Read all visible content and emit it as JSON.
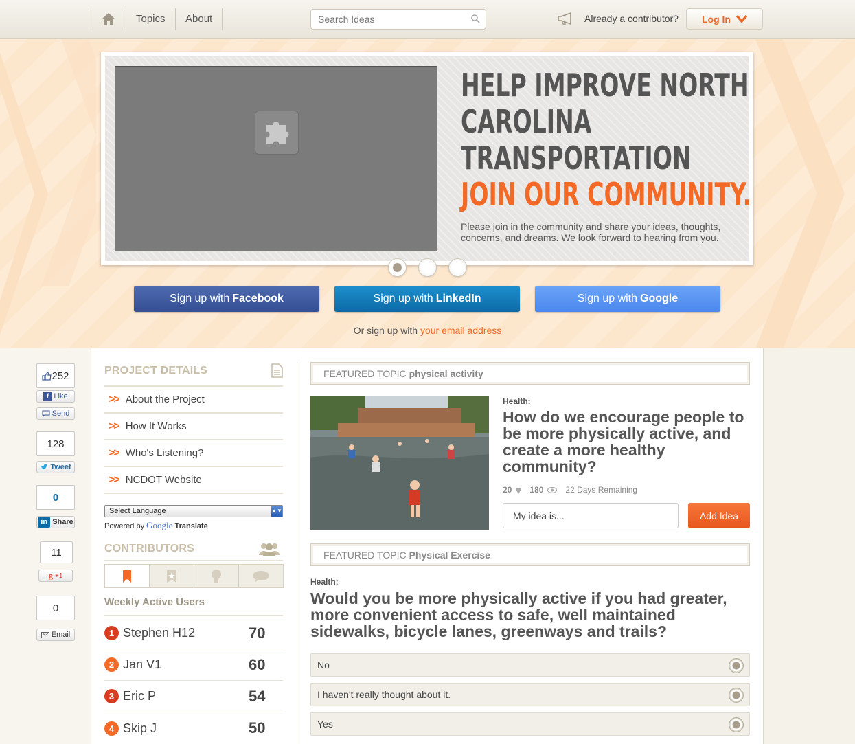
{
  "nav": {
    "links": [
      "Topics",
      "About"
    ],
    "search_placeholder": "Search Ideas",
    "contributor_text": "Already a contributor?",
    "login_label": "Log In"
  },
  "hero": {
    "headline_lines": [
      "HELP IMPROVE NORTH",
      "CAROLINA",
      "TRANSPORTATION"
    ],
    "headline_accent": "JOIN OUR COMMUNITY.",
    "intro": "Please join in the community and share your ideas, thoughts, concerns, and dreams. We look forward to hearing from you.",
    "signup": {
      "prefix": "Sign up with",
      "facebook": "Facebook",
      "linkedin": "LinkedIn",
      "google": "Google"
    },
    "or_text": "Or sign up with",
    "email_link": "your email address"
  },
  "share": {
    "like_count": "252",
    "like_label": "Like",
    "send_label": "Send",
    "tweet_count": "128",
    "tweet_label": "Tweet",
    "linkedin_count": "0",
    "linkedin_label": "Share",
    "gplus_count": "11",
    "gplus_label": "+1",
    "email_count": "0",
    "email_label": "Email"
  },
  "project": {
    "title": "PROJECT DETAILS",
    "items": [
      "About the Project",
      "How It Works",
      "Who's Listening?",
      "NCDOT Website"
    ],
    "language_select": "Select Language",
    "powered_by": "Powered by",
    "google": "Google",
    "translate": "Translate"
  },
  "contributors": {
    "title": "CONTRIBUTORS",
    "subtitle": "Weekly Active Users",
    "users": [
      {
        "rank": "1",
        "name": "Stephen H12",
        "score": "70"
      },
      {
        "rank": "2",
        "name": "Jan V1",
        "score": "60"
      },
      {
        "rank": "3",
        "name": "Eric P",
        "score": "54"
      },
      {
        "rank": "4",
        "name": "Skip J",
        "score": "50"
      }
    ]
  },
  "featured1": {
    "label": "FEATURED TOPIC",
    "topic": "physical activity",
    "category": "Health:",
    "question": "How do we encourage people to be more physically active, and create a more healthy community?",
    "ideas": "20",
    "views": "180",
    "remaining": "22 Days Remaining",
    "input_value": "My idea is...",
    "add_label": "Add Idea"
  },
  "featured2": {
    "label": "FEATURED TOPIC",
    "topic": "Physical Exercise",
    "category": "Health:",
    "question": "Would you be more physically active if you had greater, more convenient access to safe, well maintained sidewalks, bicycle lanes, greenways and trails?",
    "options": [
      "No",
      "I haven't really thought about it.",
      "Yes"
    ]
  }
}
